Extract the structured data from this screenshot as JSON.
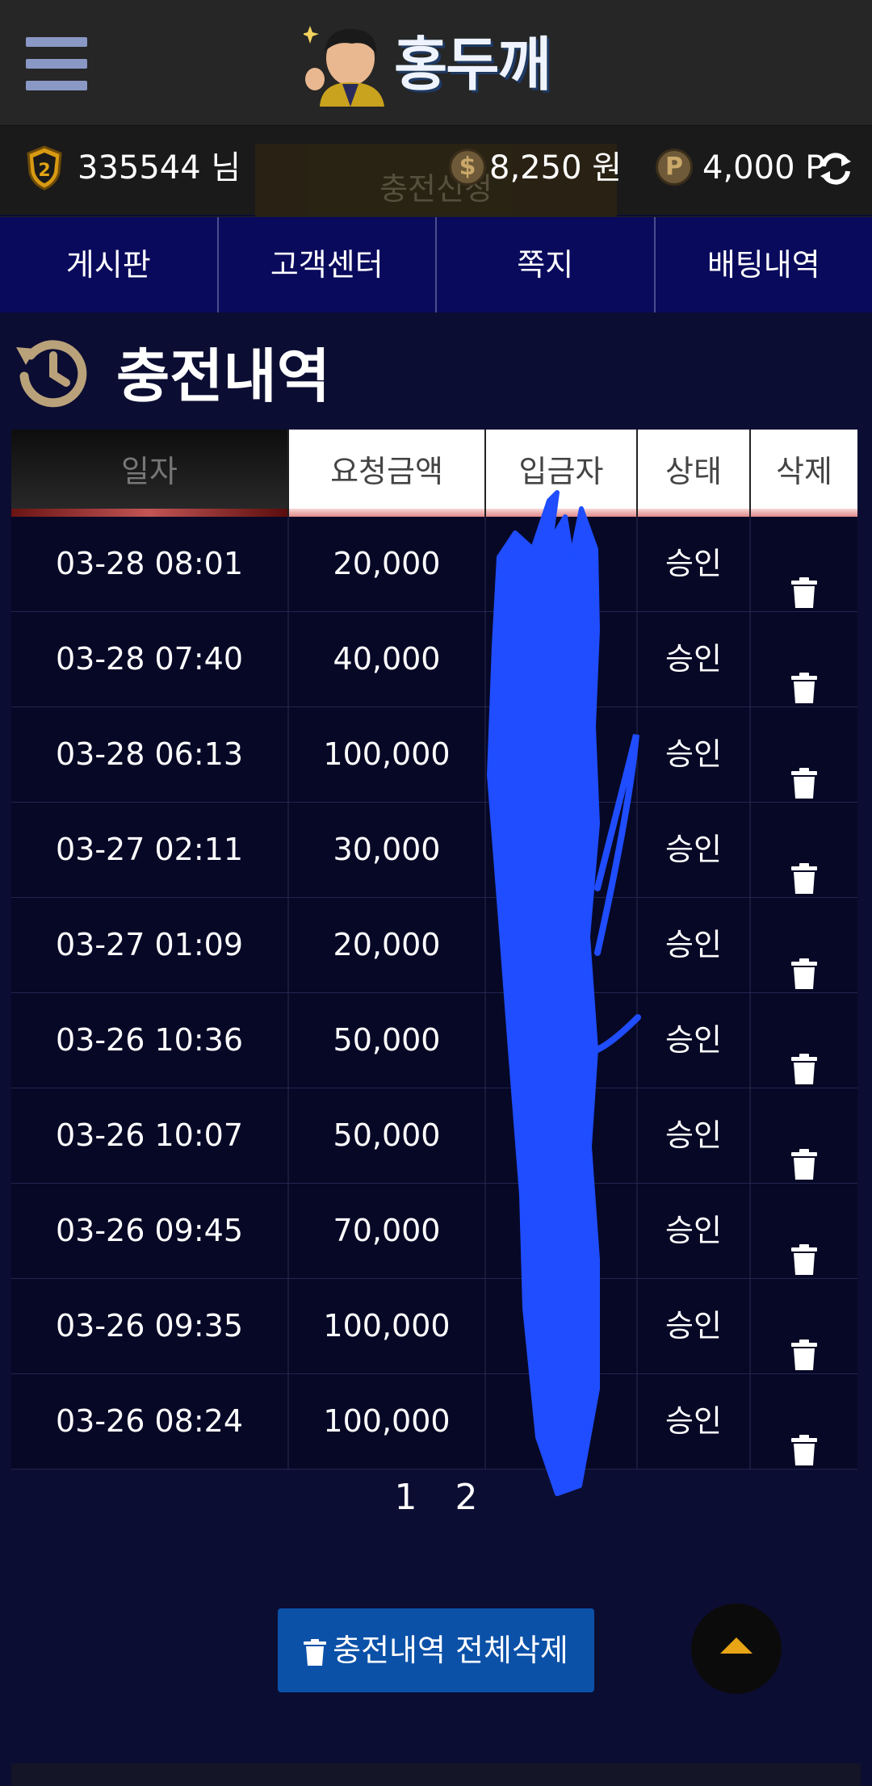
{
  "header": {
    "logo_text": "홍두깨"
  },
  "userbar": {
    "user_id": "335544 님",
    "ghost_button": "충전신청",
    "money": "8,250 원",
    "points": "4,000 P",
    "level": "2"
  },
  "nav": {
    "items": [
      {
        "label": "게시판"
      },
      {
        "label": "고객센터"
      },
      {
        "label": "쪽지"
      },
      {
        "label": "배팅내역"
      }
    ]
  },
  "page": {
    "title": "충전내역"
  },
  "table": {
    "headers": [
      "일자",
      "요청금액",
      "입금자",
      "상태",
      "삭제"
    ],
    "rows": [
      {
        "date": "03-28 08:01",
        "amount": "20,000",
        "depositor": "",
        "status": "승인"
      },
      {
        "date": "03-28 07:40",
        "amount": "40,000",
        "depositor": "",
        "status": "승인"
      },
      {
        "date": "03-28 06:13",
        "amount": "100,000",
        "depositor": "",
        "status": "승인"
      },
      {
        "date": "03-27 02:11",
        "amount": "30,000",
        "depositor": "",
        "status": "승인"
      },
      {
        "date": "03-27 01:09",
        "amount": "20,000",
        "depositor": "",
        "status": "승인"
      },
      {
        "date": "03-26 10:36",
        "amount": "50,000",
        "depositor": "",
        "status": "승인"
      },
      {
        "date": "03-26 10:07",
        "amount": "50,000",
        "depositor": "",
        "status": "승인"
      },
      {
        "date": "03-26 09:45",
        "amount": "70,000",
        "depositor": "",
        "status": "승인"
      },
      {
        "date": "03-26 09:35",
        "amount": "100,000",
        "depositor": "",
        "status": "승인"
      },
      {
        "date": "03-26 08:24",
        "amount": "100,000",
        "depositor": "",
        "status": "승인"
      }
    ]
  },
  "pagination": {
    "pages": [
      "1",
      "2"
    ]
  },
  "actions": {
    "delete_all": "충전내역 전체삭제"
  },
  "colors": {
    "nav_bg": "#090a5c",
    "page_bg": "#0c0d33",
    "delete_button": "#0b51a8",
    "scroll_top_arrow": "#e8a516",
    "redaction": "#1f4dff"
  }
}
